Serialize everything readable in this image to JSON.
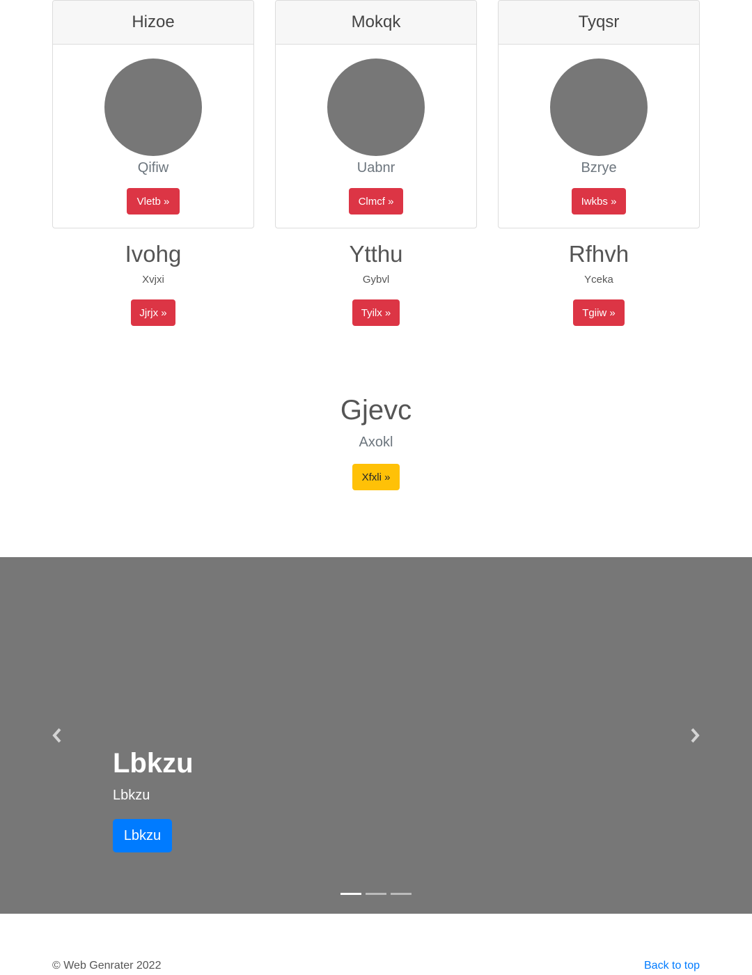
{
  "cards": [
    {
      "header": "Hizoe",
      "subtitle": "Qifiw",
      "button": "Vletb »"
    },
    {
      "header": "Mokqk",
      "subtitle": "Uabnr",
      "button": "Clmcf »"
    },
    {
      "header": "Tyqsr",
      "subtitle": "Bzrye",
      "button": "Iwkbs »"
    }
  ],
  "columns": [
    {
      "heading": "Ivohg",
      "text": "Xvjxi",
      "button": "Jjrjx »"
    },
    {
      "heading": "Ytthu",
      "text": "Gybvl",
      "button": "Tyilx »"
    },
    {
      "heading": "Rfhvh",
      "text": "Yceka",
      "button": "Tgiiw »"
    }
  ],
  "featured": {
    "title": "Gjevc",
    "subtitle": "Axokl",
    "button": "Xfxli »"
  },
  "carousel": {
    "title": "Lbkzu",
    "subtitle": "Lbkzu",
    "button": "Lbkzu",
    "prev_icon": "chevron-left-icon",
    "next_icon": "chevron-right-icon",
    "slide_count": 3,
    "active_slide": 1
  },
  "footer": {
    "copyright": "© Web Genrater 2022",
    "back_to_top": "Back to top"
  },
  "colors": {
    "danger": "#dc3545",
    "warning": "#ffc107",
    "primary": "#007bff",
    "placeholder": "#777777"
  }
}
